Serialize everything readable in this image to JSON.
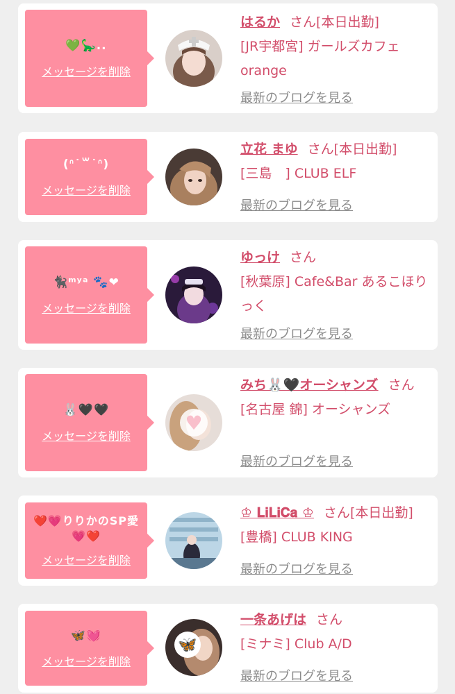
{
  "delete_label": "メッセージを削除",
  "blog_label": "最新のブログを見る",
  "san_label": "さん",
  "colors": {
    "page_bg": "#efefef",
    "card_bg": "#ffffff",
    "message_bg": "#fe8fa1",
    "name_color": "#d24d6a",
    "blog_link_color": "#8c8c8c"
  },
  "cards": [
    {
      "message": "💚🦕..",
      "name": "はるか",
      "status": "[本日出勤]",
      "shop": "[JR宇都宮] ガールズカフェorange",
      "avatar_icon": "nurse-cap-avatar-icon"
    },
    {
      "message": "(ᐢ˙꒳˙ᐢ)",
      "name": "立花 まゆ",
      "status": "[本日出勤]",
      "shop": "[三島　] CLUB ELF",
      "avatar_icon": "portrait-avatar-icon"
    },
    {
      "message": "🐈‍⬛ᵐʸᵃ 🐾❤",
      "name": "ゆっけ",
      "status": "",
      "shop": "[秋葉原] Cafe&Bar あるこほりっく",
      "avatar_icon": "costume-avatar-icon"
    },
    {
      "message": "🐰🖤🖤",
      "name": "みち🐰🖤オーシャンズ",
      "status": "",
      "shop": "[名古屋 錦] オーシャンズ",
      "avatar_icon": "heart-blur-avatar-icon"
    },
    {
      "message": "❤️💗りりかのSP愛💗❤️",
      "name": "♔ 𝐋𝐢𝐋𝐢𝐂𝐚 ♔",
      "status": "[本日出勤]",
      "shop": "[豊橋] CLUB KING",
      "avatar_icon": "mirror-selfie-avatar-icon"
    },
    {
      "message": "🦋💓",
      "name": "一条あげは",
      "status": "",
      "shop": "[ミナミ] Club A/D",
      "avatar_icon": "butterfly-avatar-icon"
    }
  ]
}
